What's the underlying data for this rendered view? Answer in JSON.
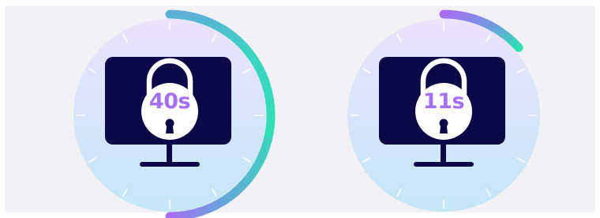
{
  "timers": [
    {
      "label": "40s",
      "seconds": 40,
      "progress": 0.5,
      "start_fraction": 0.0,
      "end_fraction": 0.5
    },
    {
      "label": "11s",
      "seconds": 11,
      "progress": 0.1333,
      "start_fraction": 0.0,
      "end_fraction": 0.1333
    }
  ],
  "colors": {
    "page_background": "#f2f1f6",
    "dial_top": "#ece2fb",
    "dial_bottom": "#c3e7f7",
    "monitor": "#0c0848",
    "padlock_body": "#ffffff",
    "label": "#a370f0",
    "arc_start": "#2fe0b2",
    "arc_end": "#a86ff0",
    "tick": "#ffffff"
  },
  "icons": {
    "monitor": "monitor-icon",
    "padlock": "padlock-icon",
    "keyhole": "keyhole-icon"
  }
}
